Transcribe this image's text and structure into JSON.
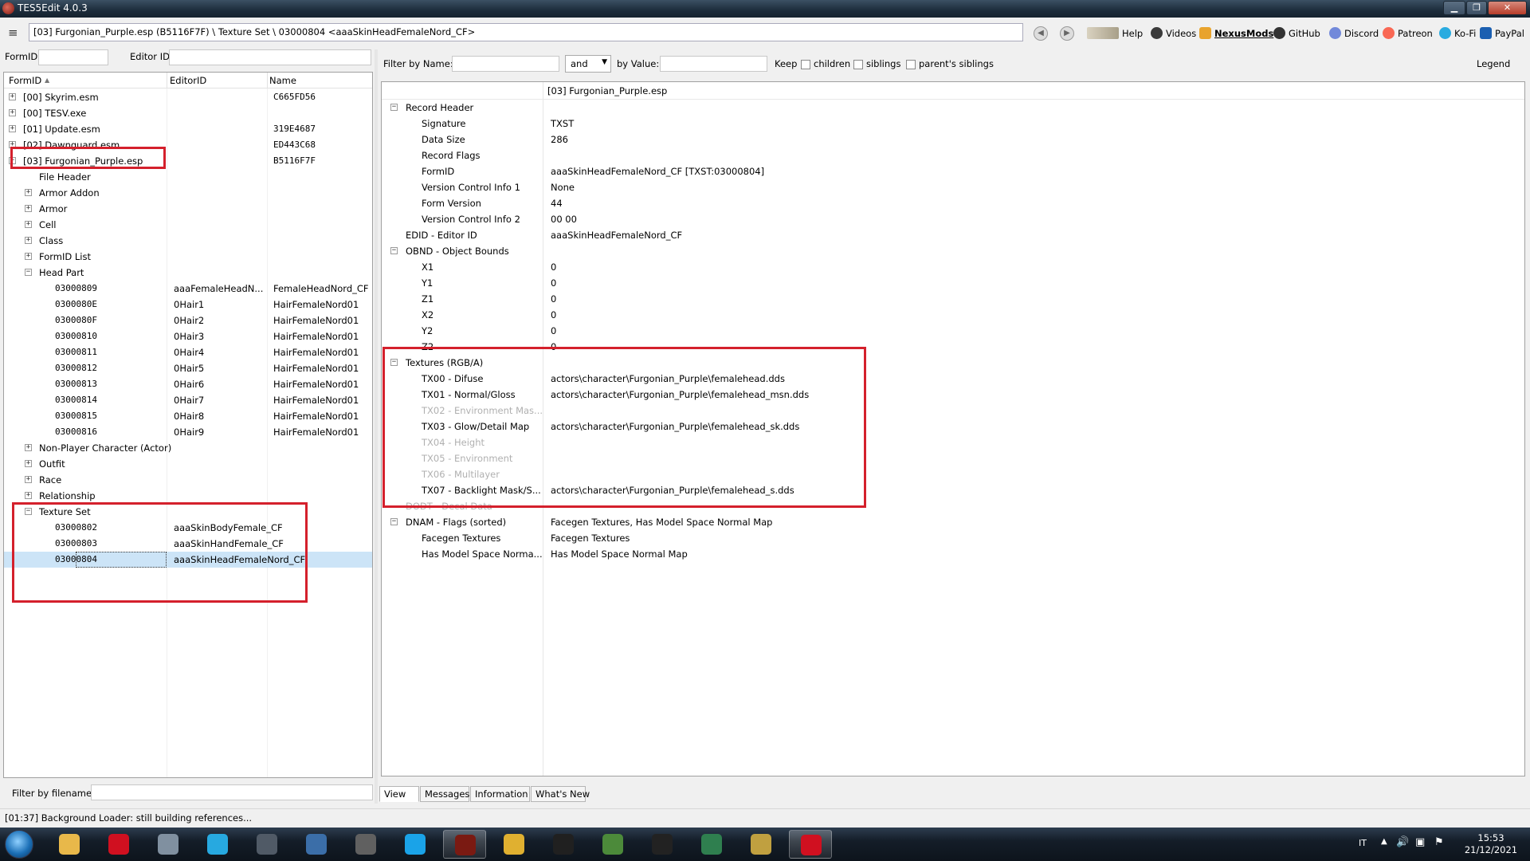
{
  "window": {
    "title": "TES5Edit 4.0.3"
  },
  "path": "[03] Furgonian_Purple.esp (B5116F7F) \\ Texture Set \\ 03000804 <aaaSkinHeadFemaleNord_CF>",
  "links": [
    {
      "label": "Help",
      "icon": "book-icon"
    },
    {
      "label": "Videos",
      "icon": "film-reel-icon"
    },
    {
      "label": "NexusMods",
      "icon": "nexus-icon"
    },
    {
      "label": "GitHub",
      "icon": "github-icon"
    },
    {
      "label": "Discord",
      "icon": "discord-icon"
    },
    {
      "label": "Patreon",
      "icon": "patreon-icon"
    },
    {
      "label": "Ko-Fi",
      "icon": "kofi-icon"
    },
    {
      "label": "PayPal",
      "icon": "paypal-icon"
    }
  ],
  "left": {
    "formid_label": "FormID",
    "editorid_label": "Editor ID",
    "columns": [
      "FormID",
      "EditorID",
      "Name"
    ],
    "rows": [
      {
        "level": 0,
        "exp": "+",
        "formid": "[00] Skyrim.esm",
        "editorid": "",
        "name": "C665FD56"
      },
      {
        "level": 0,
        "exp": "+",
        "formid": "[00] TESV.exe",
        "editorid": "",
        "name": ""
      },
      {
        "level": 0,
        "exp": "+",
        "formid": "[01] Update.esm",
        "editorid": "",
        "name": "319E4687"
      },
      {
        "level": 0,
        "exp": "+",
        "formid": "[02] Dawnguard.esm",
        "editorid": "",
        "name": "ED443C68"
      },
      {
        "level": 0,
        "exp": "−",
        "formid": "[03] Furgonian_Purple.esp",
        "editorid": "",
        "name": "B5116F7F"
      },
      {
        "level": 1,
        "exp": "",
        "formid": "File Header",
        "editorid": "",
        "name": ""
      },
      {
        "level": 1,
        "exp": "+",
        "formid": "Armor Addon",
        "editorid": "",
        "name": ""
      },
      {
        "level": 1,
        "exp": "+",
        "formid": "Armor",
        "editorid": "",
        "name": ""
      },
      {
        "level": 1,
        "exp": "+",
        "formid": "Cell",
        "editorid": "",
        "name": ""
      },
      {
        "level": 1,
        "exp": "+",
        "formid": "Class",
        "editorid": "",
        "name": ""
      },
      {
        "level": 1,
        "exp": "+",
        "formid": "FormID List",
        "editorid": "",
        "name": ""
      },
      {
        "level": 1,
        "exp": "−",
        "formid": "Head Part",
        "editorid": "",
        "name": ""
      },
      {
        "level": 2,
        "exp": "",
        "formid": "03000809",
        "editorid": "aaaFemaleHeadN...",
        "name": "FemaleHeadNord_CF"
      },
      {
        "level": 2,
        "exp": "",
        "formid": "0300080E",
        "editorid": "0Hair1",
        "name": "HairFemaleNord01"
      },
      {
        "level": 2,
        "exp": "",
        "formid": "0300080F",
        "editorid": "0Hair2",
        "name": "HairFemaleNord01"
      },
      {
        "level": 2,
        "exp": "",
        "formid": "03000810",
        "editorid": "0Hair3",
        "name": "HairFemaleNord01"
      },
      {
        "level": 2,
        "exp": "",
        "formid": "03000811",
        "editorid": "0Hair4",
        "name": "HairFemaleNord01"
      },
      {
        "level": 2,
        "exp": "",
        "formid": "03000812",
        "editorid": "0Hair5",
        "name": "HairFemaleNord01"
      },
      {
        "level": 2,
        "exp": "",
        "formid": "03000813",
        "editorid": "0Hair6",
        "name": "HairFemaleNord01"
      },
      {
        "level": 2,
        "exp": "",
        "formid": "03000814",
        "editorid": "0Hair7",
        "name": "HairFemaleNord01"
      },
      {
        "level": 2,
        "exp": "",
        "formid": "03000815",
        "editorid": "0Hair8",
        "name": "HairFemaleNord01"
      },
      {
        "level": 2,
        "exp": "",
        "formid": "03000816",
        "editorid": "0Hair9",
        "name": "HairFemaleNord01"
      },
      {
        "level": 1,
        "exp": "+",
        "formid": "Non-Player Character (Actor)",
        "editorid": "",
        "name": ""
      },
      {
        "level": 1,
        "exp": "+",
        "formid": "Outfit",
        "editorid": "",
        "name": ""
      },
      {
        "level": 1,
        "exp": "+",
        "formid": "Race",
        "editorid": "",
        "name": ""
      },
      {
        "level": 1,
        "exp": "+",
        "formid": "Relationship",
        "editorid": "",
        "name": ""
      },
      {
        "level": 1,
        "exp": "−",
        "formid": "Texture Set",
        "editorid": "",
        "name": ""
      },
      {
        "level": 2,
        "exp": "",
        "formid": "03000802",
        "editorid": "aaaSkinBodyFemale_CF",
        "name": ""
      },
      {
        "level": 2,
        "exp": "",
        "formid": "03000803",
        "editorid": "aaaSkinHandFemale_CF",
        "name": ""
      },
      {
        "level": 2,
        "exp": "",
        "formid": "03000804",
        "editorid": "aaaSkinHeadFemaleNord_CF",
        "name": "",
        "selected": true
      }
    ],
    "filter_filename_label": "Filter by filename:"
  },
  "right": {
    "filter_name_label": "Filter by Name:",
    "operator": "and",
    "filter_value_label": "by Value:",
    "keep_label": "Keep",
    "children_label": "children",
    "siblings_label": "siblings",
    "parent_siblings_label": "parent's siblings",
    "legend_label": "Legend",
    "column_header": "[03] Furgonian_Purple.esp",
    "records": [
      {
        "level": 0,
        "exp": "−",
        "name": "Record Header",
        "value": ""
      },
      {
        "level": 1,
        "exp": "",
        "name": "Signature",
        "value": "TXST"
      },
      {
        "level": 1,
        "exp": "",
        "name": "Data Size",
        "value": "286"
      },
      {
        "level": 1,
        "exp": "",
        "name": "Record Flags",
        "value": ""
      },
      {
        "level": 1,
        "exp": "",
        "name": "FormID",
        "value": "aaaSkinHeadFemaleNord_CF [TXST:03000804]"
      },
      {
        "level": 1,
        "exp": "",
        "name": "Version Control Info 1",
        "value": "None"
      },
      {
        "level": 1,
        "exp": "",
        "name": "Form Version",
        "value": "44"
      },
      {
        "level": 1,
        "exp": "",
        "name": "Version Control Info 2",
        "value": "00 00"
      },
      {
        "level": 0,
        "exp": "",
        "name": "EDID - Editor ID",
        "value": "aaaSkinHeadFemaleNord_CF"
      },
      {
        "level": 0,
        "exp": "−",
        "name": "OBND - Object Bounds",
        "value": ""
      },
      {
        "level": 1,
        "exp": "",
        "name": "X1",
        "value": "0"
      },
      {
        "level": 1,
        "exp": "",
        "name": "Y1",
        "value": "0"
      },
      {
        "level": 1,
        "exp": "",
        "name": "Z1",
        "value": "0"
      },
      {
        "level": 1,
        "exp": "",
        "name": "X2",
        "value": "0"
      },
      {
        "level": 1,
        "exp": "",
        "name": "Y2",
        "value": "0"
      },
      {
        "level": 1,
        "exp": "",
        "name": "Z2",
        "value": "0"
      },
      {
        "level": 0,
        "exp": "−",
        "name": "Textures (RGB/A)",
        "value": ""
      },
      {
        "level": 1,
        "exp": "",
        "name": "TX00 - Difuse",
        "value": "actors\\character\\Furgonian_Purple\\femalehead.dds"
      },
      {
        "level": 1,
        "exp": "",
        "name": "TX01 - Normal/Gloss",
        "value": "actors\\character\\Furgonian_Purple\\femalehead_msn.dds"
      },
      {
        "level": 1,
        "exp": "",
        "name": "TX02 - Environment Mas...",
        "value": "",
        "dim": true
      },
      {
        "level": 1,
        "exp": "",
        "name": "TX03 - Glow/Detail Map",
        "value": "actors\\character\\Furgonian_Purple\\femalehead_sk.dds"
      },
      {
        "level": 1,
        "exp": "",
        "name": "TX04 - Height",
        "value": "",
        "dim": true
      },
      {
        "level": 1,
        "exp": "",
        "name": "TX05 - Environment",
        "value": "",
        "dim": true
      },
      {
        "level": 1,
        "exp": "",
        "name": "TX06 - Multilayer",
        "value": "",
        "dim": true
      },
      {
        "level": 1,
        "exp": "",
        "name": "TX07 - Backlight Mask/S...",
        "value": "actors\\character\\Furgonian_Purple\\femalehead_s.dds"
      },
      {
        "level": 0,
        "exp": "",
        "name": "DODT - Decal Data",
        "value": "",
        "dim": true
      },
      {
        "level": 0,
        "exp": "−",
        "name": "DNAM - Flags (sorted)",
        "value": "Facegen Textures, Has Model Space Normal Map"
      },
      {
        "level": 1,
        "exp": "",
        "name": "Facegen Textures",
        "value": "Facegen Textures"
      },
      {
        "level": 1,
        "exp": "",
        "name": "Has Model Space Norma...",
        "value": "Has Model Space Normal Map"
      }
    ],
    "tabs": [
      "View",
      "Messages",
      "Information",
      "What's New"
    ]
  },
  "status": "[01:37] Background Loader: still building references...",
  "taskbar": {
    "apps": [
      {
        "icon": "explorer-icon",
        "color": "#e8b84a"
      },
      {
        "icon": "opera-icon",
        "color": "#d01020"
      },
      {
        "icon": "calculator-icon",
        "color": "#8090a0"
      },
      {
        "icon": "music-icon",
        "color": "#27a9e0"
      },
      {
        "icon": "audio-editor-icon",
        "color": "#505a66"
      },
      {
        "icon": "ffdec-icon",
        "color": "#3b6ea8"
      },
      {
        "icon": "equalizer-icon",
        "color": "#606060"
      },
      {
        "icon": "skype-icon",
        "color": "#1aa3e8"
      },
      {
        "icon": "tes5edit-icon",
        "color": "#7a1a12",
        "active": true
      },
      {
        "icon": "notes-icon",
        "color": "#e0b030"
      },
      {
        "icon": "skyrim-icon",
        "color": "#202020"
      },
      {
        "icon": "security-icon",
        "color": "#4c8a3a"
      },
      {
        "icon": "mod-manager-icon",
        "color": "#222222"
      },
      {
        "icon": "spreadsheet-icon",
        "color": "#2f7f4f"
      },
      {
        "icon": "arrow-app-icon",
        "color": "#c0a040"
      },
      {
        "icon": "opera-gx-icon",
        "color": "#d01020",
        "active": true
      }
    ],
    "language": "IT",
    "time": "15:53",
    "date": "21/12/2021"
  }
}
